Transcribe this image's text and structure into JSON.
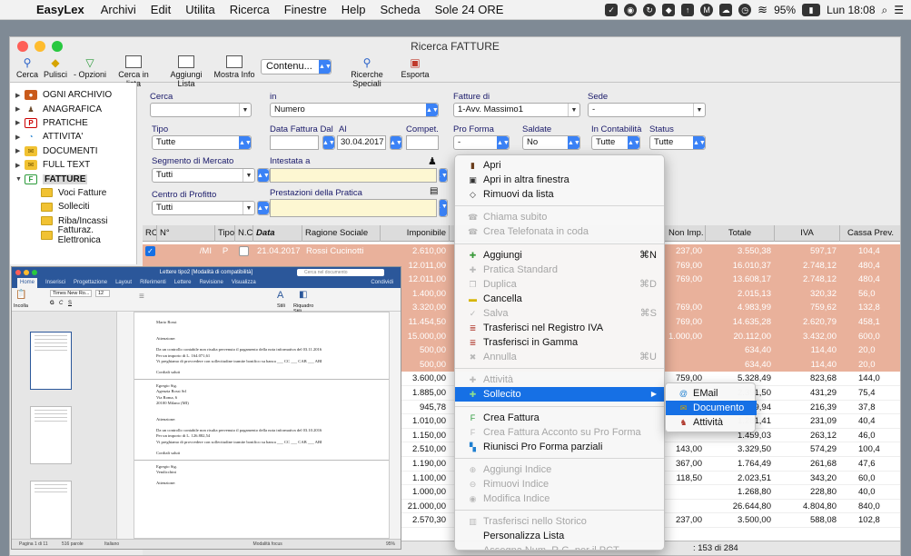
{
  "menubar": {
    "app": "EasyLex",
    "menus": [
      "Archivi",
      "Edit",
      "Utilita",
      "Ricerca",
      "Finestre",
      "Help",
      "Scheda",
      "Sole 24 ORE"
    ],
    "battery": "95%",
    "clock": "Lun 18:08"
  },
  "window": {
    "title": "Ricerca FATTURE",
    "toolbar": {
      "cerca": "Cerca",
      "pulisci": "Pulisci",
      "opzioni": "- Opzioni",
      "cerca_lista": "Cerca in lista",
      "aggiungi_lista": "Aggiungi Lista",
      "mostra_info": "Mostra Info",
      "content_select": "Contenu...",
      "ricerche_speciali": "Ricerche Speciali",
      "esporta": "Esporta"
    }
  },
  "sidebar": {
    "items": [
      "OGNI ARCHIVIO",
      "ANAGRAFICA",
      "PRATICHE",
      "ATTIVITA'",
      "DOCUMENTI",
      "FULL TEXT",
      "FATTURE"
    ],
    "subitems": [
      "Voci Fatture",
      "Solleciti",
      "Riba/Incassi",
      "Fatturaz. Elettronica"
    ]
  },
  "form": {
    "cerca_label": "Cerca",
    "in_label": "in",
    "in_value": "Numero",
    "fatture_di_label": "Fatture di",
    "fatture_di_value": "1-Avv. Massimo1",
    "sede_label": "Sede",
    "sede_value": "-",
    "tipo_label": "Tipo",
    "tipo_value": "Tutte",
    "data_fattura_label": "Data Fattura Dal",
    "al_label": "Al",
    "al_value": "30.04.2017",
    "compet_label": "Compet.",
    "proforma_label": "Pro Forma",
    "proforma_value": "-",
    "saldate_label": "Saldate",
    "saldate_value": "No",
    "contabilita_label": "In Contabilità",
    "contabilita_value": "Tutte",
    "status_label": "Status",
    "status_value": "Tutte",
    "segmento_label": "Segmento di Mercato",
    "segmento_value": "Tutti",
    "intestata_label": "Intestata a",
    "centro_label": "Centro di Profitto",
    "centro_value": "Tutti",
    "prestazioni_label": "Prestazioni della Pratica"
  },
  "table": {
    "headers": {
      "rc": "RC",
      "n": "N°",
      "tipo": "Tipo",
      "nc": "N.C.",
      "data": "Data",
      "ragione": "Ragione Sociale",
      "imponibile": "Imponibile",
      "non_imp": "Non Imp.",
      "totale": "Totale",
      "iva": "IVA",
      "cassa": "Cassa Prev."
    },
    "first_row": {
      "n": "/MI",
      "tipo": "P",
      "data": "21.04.2017",
      "ragione": "Rossi Cucinotti"
    },
    "rows": [
      {
        "imp": "2.610,00",
        "nonimp": "237,00",
        "tot": "3.550,38",
        "iva": "597,17",
        "cassa": "104,4",
        "hl": true
      },
      {
        "imp": "12.011,00",
        "nonimp": "769,00",
        "tot": "16.010,37",
        "iva": "2.748,12",
        "cassa": "480,4",
        "hl": true
      },
      {
        "imp": "12.011,00",
        "nonimp": "769,00",
        "tot": "13.608,17",
        "iva": "2.748,12",
        "cassa": "480,4",
        "hl": true
      },
      {
        "imp": "1.400,00",
        "nonimp": "",
        "tot": "2.015,13",
        "iva": "320,32",
        "cassa": "56,0",
        "hl": true
      },
      {
        "imp": "3.320,00",
        "nonimp": "769,00",
        "tot": "4.983,99",
        "iva": "759,62",
        "cassa": "132,8",
        "hl": true
      },
      {
        "imp": "11.454,50",
        "nonimp": "769,00",
        "tot": "14.635,28",
        "iva": "2.620,79",
        "cassa": "458,1",
        "hl": true
      },
      {
        "imp": "15.000,00",
        "nonimp": "1.000,00",
        "tot": "20.112,00",
        "iva": "3.432,00",
        "cassa": "600,0",
        "hl": true
      },
      {
        "imp": "500,00",
        "nonimp": "",
        "tot": "634,40",
        "iva": "114,40",
        "cassa": "20,0",
        "hl": true
      },
      {
        "imp": "500,00",
        "nonimp": "",
        "tot": "634,40",
        "iva": "114,40",
        "cassa": "20,0",
        "hl": true
      },
      {
        "imp": "3.600,00",
        "nonimp": "759,00",
        "tot": "5.328,49",
        "iva": "823,68",
        "cassa": "144,0",
        "hl": false
      },
      {
        "imp": "1.885,00",
        "nonimp": "",
        "tot": "2.391,50",
        "iva": "431,29",
        "cassa": "75,4",
        "hl": false
      },
      {
        "imp": "945,78",
        "nonimp": "",
        "tot": "1.199,94",
        "iva": "216,39",
        "cassa": "37,8",
        "hl": false
      },
      {
        "imp": "1.010,00",
        "nonimp": "",
        "tot": "1.281,41",
        "iva": "231,09",
        "cassa": "40,4",
        "hl": false
      },
      {
        "imp": "1.150,00",
        "nonimp": "",
        "tot": "1.459,03",
        "iva": "263,12",
        "cassa": "46,0",
        "hl": false
      },
      {
        "imp": "2.510,00",
        "nonimp": "143,00",
        "tot": "3.329,50",
        "iva": "574,29",
        "cassa": "100,4",
        "hl": false
      },
      {
        "imp": "1.190,00",
        "nonimp": "367,00",
        "tot": "1.764,49",
        "iva": "261,68",
        "cassa": "47,6",
        "hl": false
      },
      {
        "imp": "1.100,00",
        "nonimp": "118,50",
        "tot": "2.023,51",
        "iva": "343,20",
        "cassa": "60,0",
        "hl": false
      },
      {
        "imp": "1.000,00",
        "nonimp": "",
        "tot": "1.268,80",
        "iva": "228,80",
        "cassa": "40,0",
        "hl": false
      },
      {
        "imp": "21.000,00",
        "nonimp": "",
        "tot": "26.644,80",
        "iva": "4.804,80",
        "cassa": "840,0",
        "hl": false
      },
      {
        "imp": "2.570,30",
        "nonimp": "237,00",
        "tot": "3.500,00",
        "iva": "588,08",
        "cassa": "102,8",
        "hl": false
      }
    ],
    "status_count": ": 153 di 284"
  },
  "word": {
    "title": "Lettere tipo2 [Modalità di compatibilità]",
    "search_placeholder": "Cerca nel documento",
    "share": "Condividi",
    "tabs": [
      "Home",
      "Inserisci",
      "Progettazione",
      "Layout",
      "Riferimenti",
      "Lettere",
      "Revisione",
      "Visualizza"
    ],
    "font": "Times New Ro...",
    "size": "12",
    "stili": "Stili",
    "riquadro": "Riquadro Stili",
    "incolla": "Incolla",
    "doc": {
      "name1": "Mario Rossi",
      "att1": "Attenzione:",
      "p1": "Da un controllo contabile non risulta pervenuto il pagamento della nota informativa del 03.11.2016",
      "p1b": "Per un importo di L. 164.071,61",
      "p1c": "Vi preghiamo di provvedere con sollecitudine tramite bonifico su banca ___ CC ___ CAB ___ ABI",
      "saluti1": "Cordiali saluti",
      "egregio": "Egregio Sig.",
      "agenzia": "Agenzia Rossi Srl",
      "via": "Via Roma, 6",
      "citta": "20100 Milano (MI)",
      "att2": "Attenzione:",
      "p2": "Da un controllo contabile non risulta pervenuto il pagamento della nota informativa del 03.10.2016",
      "p2b": "Per un importo di L. 126.882,54",
      "p2c": "Vi preghiamo di provvedere con sollecitudine tramite bonifico su banca ___ CC ___ CAB ___ ABI",
      "saluti2": "Cordiali saluti",
      "egregio2": "Egregio Sig.",
      "vendicchini": "Vendicchini",
      "att3": "Attenzione:"
    },
    "status": {
      "page": "Pagina 1 di 11",
      "words": "516 parole",
      "lang": "Italiano",
      "focus": "Modalità focus",
      "zoom": "95%"
    }
  },
  "context_menu": {
    "items": [
      {
        "label": "Apri",
        "icon": "door-icon",
        "enabled": true,
        "shortcut": ""
      },
      {
        "label": "Apri in altra finestra",
        "icon": "window-icon",
        "enabled": true,
        "shortcut": ""
      },
      {
        "label": "Rimuovi da lista",
        "icon": "eraser-icon",
        "enabled": true,
        "shortcut": ""
      },
      {
        "label": "Chiama subito",
        "icon": "phone-icon",
        "enabled": false,
        "shortcut": ""
      },
      {
        "label": "Crea Telefonata in coda",
        "icon": "phone-queue-icon",
        "enabled": false,
        "shortcut": ""
      },
      {
        "label": "Aggiungi",
        "icon": "plus-icon",
        "enabled": true,
        "shortcut": "⌘N"
      },
      {
        "label": "Pratica Standard",
        "icon": "plus-icon",
        "enabled": false,
        "shortcut": ""
      },
      {
        "label": "Duplica",
        "icon": "duplicate-icon",
        "enabled": false,
        "shortcut": "⌘D"
      },
      {
        "label": "Cancella",
        "icon": "trash-icon",
        "enabled": true,
        "shortcut": ""
      },
      {
        "label": "Salva",
        "icon": "check-icon",
        "enabled": false,
        "shortcut": "⌘S"
      },
      {
        "label": "Trasferisci nel Registro IVA",
        "icon": "register-icon",
        "enabled": true,
        "shortcut": ""
      },
      {
        "label": "Trasferisci in Gamma",
        "icon": "register-icon",
        "enabled": true,
        "shortcut": ""
      },
      {
        "label": "Annulla",
        "icon": "cross-icon",
        "enabled": false,
        "shortcut": "⌘U"
      },
      {
        "label": "Attività",
        "icon": "plus-icon",
        "enabled": false,
        "shortcut": ""
      },
      {
        "label": "Sollecito",
        "icon": "plus-icon",
        "enabled": true,
        "shortcut": "▶"
      },
      {
        "label": "Crea Fattura",
        "icon": "invoice-icon",
        "enabled": true,
        "shortcut": ""
      },
      {
        "label": "Crea Fattura Acconto su Pro Forma",
        "icon": "invoice-icon",
        "enabled": false,
        "shortcut": ""
      },
      {
        "label": "Riunisci Pro Forma parziali",
        "icon": "merge-icon",
        "enabled": true,
        "shortcut": ""
      },
      {
        "label": "Aggiungi Indice",
        "icon": "plus-circle-icon",
        "enabled": false,
        "shortcut": ""
      },
      {
        "label": "Rimuovi Indice",
        "icon": "minus-circle-icon",
        "enabled": false,
        "shortcut": ""
      },
      {
        "label": "Modifica Indice",
        "icon": "edit-circle-icon",
        "enabled": false,
        "shortcut": ""
      },
      {
        "label": "Trasferisci nello Storico",
        "icon": "archive-icon",
        "enabled": false,
        "shortcut": ""
      },
      {
        "label": "Personalizza Lista",
        "icon": "",
        "enabled": true,
        "shortcut": ""
      },
      {
        "label": "Assegna Num. R.G. per il PCT",
        "icon": "",
        "enabled": false,
        "shortcut": ""
      }
    ],
    "submenu": [
      {
        "label": "EMail",
        "icon": "at-icon"
      },
      {
        "label": "Documento",
        "icon": "envelope-icon"
      },
      {
        "label": "Attività",
        "icon": "activity-icon"
      }
    ]
  },
  "colors": {
    "highlight_row": "#e9b19b",
    "menu_selection": "#1670e5",
    "select_arrow": "#3b82f6",
    "word_blue": "#2b579a"
  }
}
